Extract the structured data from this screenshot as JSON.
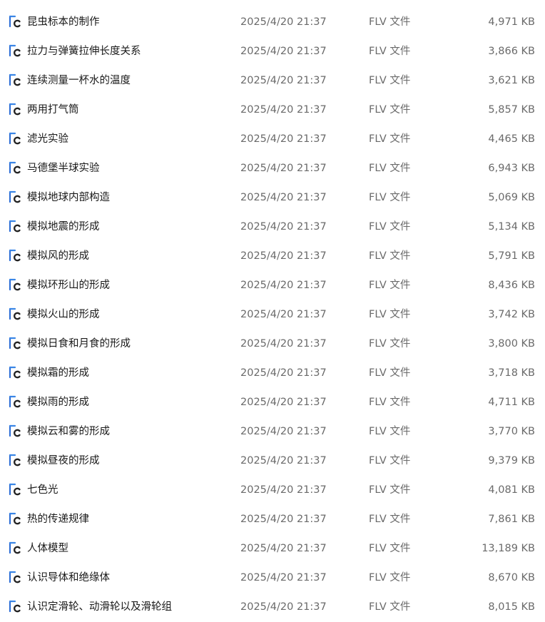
{
  "file_icon": "flv-video-file-icon",
  "colors": {
    "icon_blue": "#2f6fd6",
    "icon_purple": "#8a5cd8",
    "text_primary": "#1a1a1a",
    "text_secondary": "#6a6a6a"
  },
  "files": [
    {
      "name": "昆虫标本的制作",
      "date": "2025/4/20 21:37",
      "type": "FLV 文件",
      "size": "4,971 KB"
    },
    {
      "name": "拉力与弹簧拉伸长度关系",
      "date": "2025/4/20 21:37",
      "type": "FLV 文件",
      "size": "3,866 KB"
    },
    {
      "name": "连续测量一杯水的温度",
      "date": "2025/4/20 21:37",
      "type": "FLV 文件",
      "size": "3,621 KB"
    },
    {
      "name": "两用打气筒",
      "date": "2025/4/20 21:37",
      "type": "FLV 文件",
      "size": "5,857 KB"
    },
    {
      "name": "滤光实验",
      "date": "2025/4/20 21:37",
      "type": "FLV 文件",
      "size": "4,465 KB"
    },
    {
      "name": "马德堡半球实验",
      "date": "2025/4/20 21:37",
      "type": "FLV 文件",
      "size": "6,943 KB"
    },
    {
      "name": "模拟地球内部构造",
      "date": "2025/4/20 21:37",
      "type": "FLV 文件",
      "size": "5,069 KB"
    },
    {
      "name": "模拟地震的形成",
      "date": "2025/4/20 21:37",
      "type": "FLV 文件",
      "size": "5,134 KB"
    },
    {
      "name": "模拟风的形成",
      "date": "2025/4/20 21:37",
      "type": "FLV 文件",
      "size": "5,791 KB"
    },
    {
      "name": "模拟环形山的形成",
      "date": "2025/4/20 21:37",
      "type": "FLV 文件",
      "size": "8,436 KB"
    },
    {
      "name": "模拟火山的形成",
      "date": "2025/4/20 21:37",
      "type": "FLV 文件",
      "size": "3,742 KB"
    },
    {
      "name": "模拟日食和月食的形成",
      "date": "2025/4/20 21:37",
      "type": "FLV 文件",
      "size": "3,800 KB"
    },
    {
      "name": "模拟霜的形成",
      "date": "2025/4/20 21:37",
      "type": "FLV 文件",
      "size": "3,718 KB"
    },
    {
      "name": "模拟雨的形成",
      "date": "2025/4/20 21:37",
      "type": "FLV 文件",
      "size": "4,711 KB"
    },
    {
      "name": "模拟云和雾的形成",
      "date": "2025/4/20 21:37",
      "type": "FLV 文件",
      "size": "3,770 KB"
    },
    {
      "name": "模拟昼夜的形成",
      "date": "2025/4/20 21:37",
      "type": "FLV 文件",
      "size": "9,379 KB"
    },
    {
      "name": "七色光",
      "date": "2025/4/20 21:37",
      "type": "FLV 文件",
      "size": "4,081 KB"
    },
    {
      "name": "热的传递规律",
      "date": "2025/4/20 21:37",
      "type": "FLV 文件",
      "size": "7,861 KB"
    },
    {
      "name": "人体模型",
      "date": "2025/4/20 21:37",
      "type": "FLV 文件",
      "size": "13,189 KB"
    },
    {
      "name": "认识导体和绝缘体",
      "date": "2025/4/20 21:37",
      "type": "FLV 文件",
      "size": "8,670 KB"
    },
    {
      "name": "认识定滑轮、动滑轮以及滑轮组",
      "date": "2025/4/20 21:37",
      "type": "FLV 文件",
      "size": "8,015 KB"
    }
  ]
}
